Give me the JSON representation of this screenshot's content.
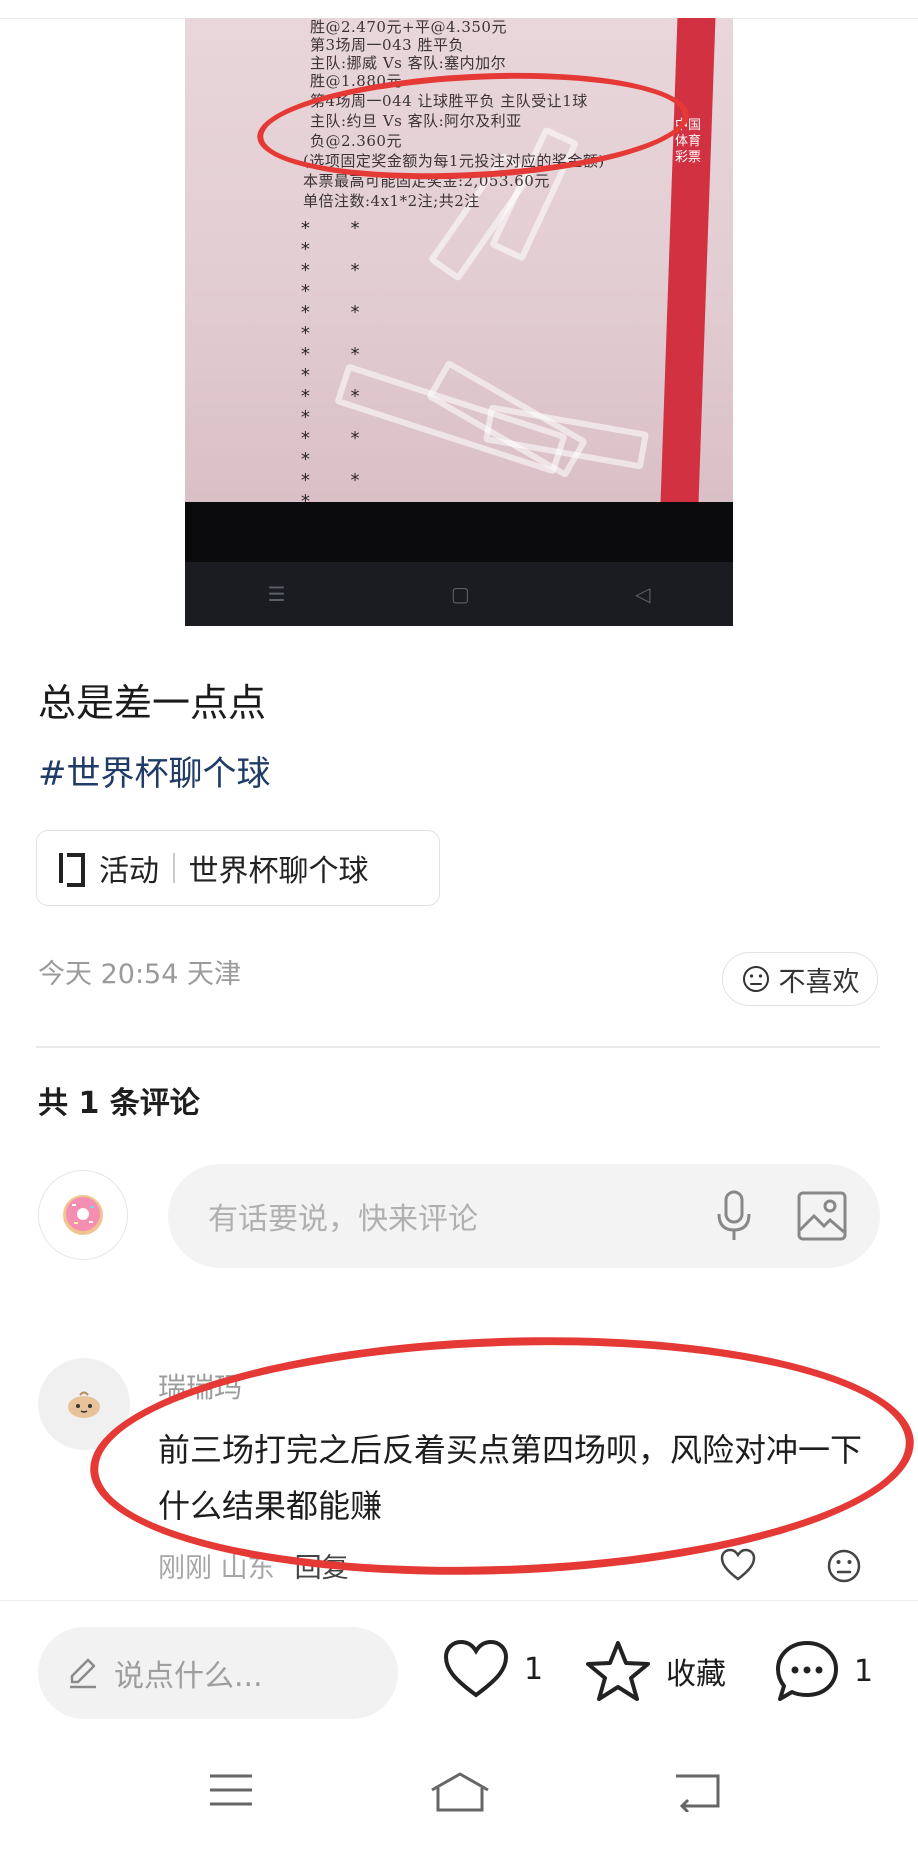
{
  "photo": {
    "receipt_lines": [
      "胜@2.470元+平@4.350元",
      "第3场周一043 胜平负",
      "主队:挪威 Vs 客队:塞内加尔",
      "胜@1.880元",
      "第4场周一044 让球胜平负 主队受让1球",
      "主队:约旦 Vs 客队:阿尔及利亚",
      "负@2.360元",
      "(选项固定奖金额为每1元投注对应的奖金额)",
      "本票最高可能固定奖金:2,053.60元",
      "单倍注数:4x1*2注;共2注"
    ],
    "ribbon_text": "中国体育彩票",
    "stars": [
      "* * *",
      "* * *",
      "* * *",
      "* * *",
      "* * *",
      "* * *",
      "* * *",
      "* * *",
      "* * *",
      "* * *",
      "* * *"
    ]
  },
  "post": {
    "title": "总是差一点点",
    "hashtag": "#世界杯聊个球",
    "activity_label": "活动",
    "activity_name": "世界杯聊个球",
    "meta": "今天 20:54 天津",
    "dislike_label": "不喜欢"
  },
  "comments_section": {
    "count_label": "共 1 条评论",
    "input_placeholder": "有话要说，快来评论"
  },
  "comment": {
    "user": "瑞瑞玛",
    "text": "前三场打完之后反着买点第四场呗，风险对冲一下什么结果都能赚",
    "meta": "刚刚 山东",
    "reply_label": "回复"
  },
  "bottom_bar": {
    "input_placeholder": "说点什么...",
    "like_count": "1",
    "collect_label": "收藏",
    "comment_count": "1"
  },
  "colors": {
    "annotation_red": "#e53935",
    "hashtag_blue": "#1f3b66"
  }
}
